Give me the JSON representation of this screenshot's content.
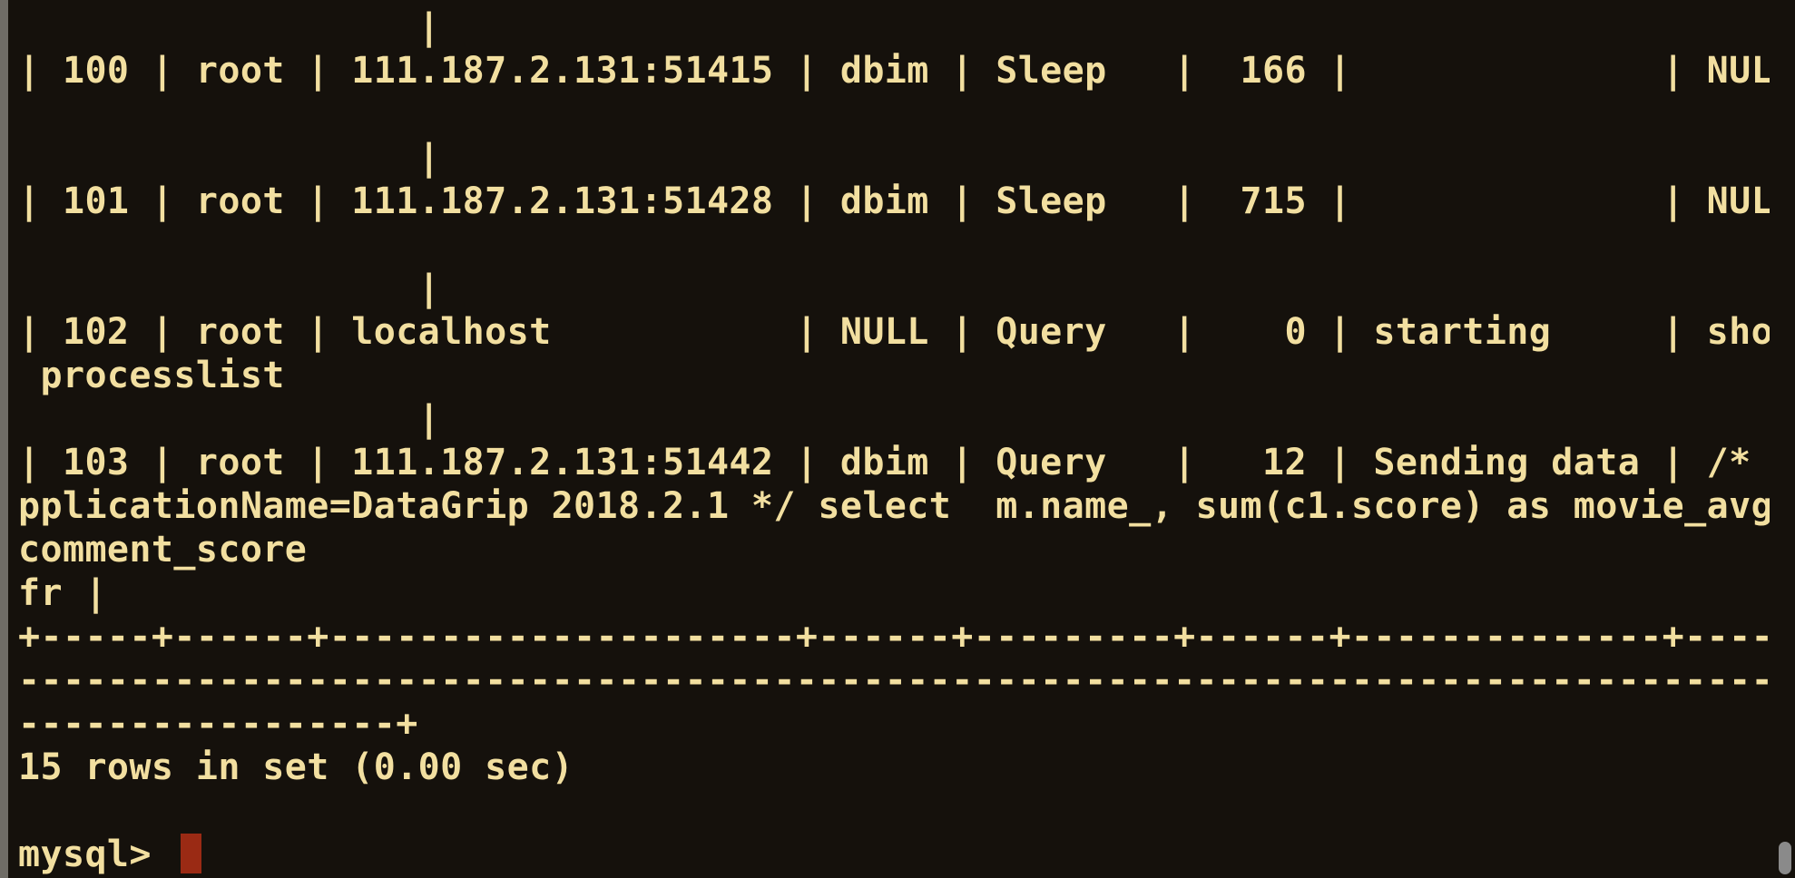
{
  "terminal": {
    "lines": [
      "                  |",
      "| 100 | root | 111.187.2.131:51415 | dbim | Sleep   |  166 |              | NULL",
      "",
      "                  |",
      "| 101 | root | 111.187.2.131:51428 | dbim | Sleep   |  715 |              | NULL",
      "",
      "                  |",
      "| 102 | root | localhost           | NULL | Query   |    0 | starting     | show",
      " processlist",
      "                  |",
      "| 103 | root | 111.187.2.131:51442 | dbim | Query   |   12 | Sending data | /* A",
      "pplicationName=DataGrip 2018.2.1 */ select  m.name_, sum(c1.score) as movie_avg_",
      "comment_score",
      "fr |",
      "+-----+------+---------------------+------+---------+------+--------------+-----",
      "--------------------------------------------------------------------------------",
      "-----------------+",
      "15 rows in set (0.00 sec)",
      ""
    ],
    "prompt": "mysql> "
  },
  "colors": {
    "background": "#15110c",
    "text": "#f2dfa0",
    "cursor": "#9a2a14"
  }
}
